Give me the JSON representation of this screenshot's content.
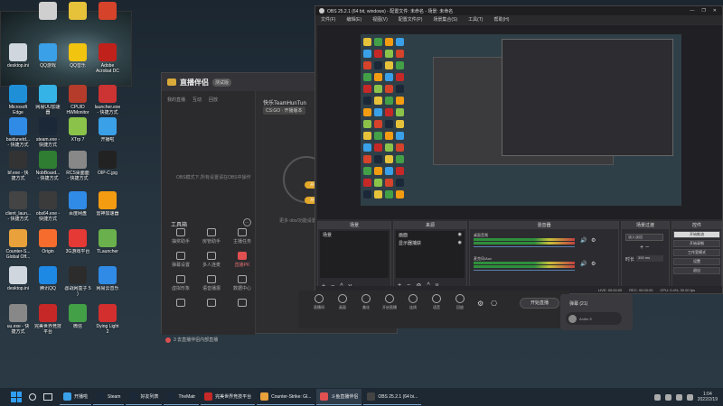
{
  "desktop": {
    "icons": [
      {
        "label": "",
        "color": "#cfcfcf"
      },
      {
        "label": "",
        "color": "#e6c23b"
      },
      {
        "label": "",
        "color": "#d4432a"
      },
      {
        "label": "desktop.ini",
        "color": "#cfd6de"
      },
      {
        "label": "QQ游戏",
        "color": "#3aa0e8"
      },
      {
        "label": "QQ音乐",
        "color": "#f1c40f"
      },
      {
        "label": "Adobe\nAcrobat DC",
        "color": "#c0211a"
      },
      {
        "label": "Microsoft\nEdge",
        "color": "#1f8fd8"
      },
      {
        "label": "网易UU加速\n器",
        "color": "#36b3e6"
      },
      {
        "label": "CPUID\nHWMonitor",
        "color": "#b53b2b"
      },
      {
        "label": "launcher.exe\n- 快捷方式",
        "color": "#cc3333"
      },
      {
        "label": "baidunetd...\n- 快捷方式",
        "color": "#2f8be6"
      },
      {
        "label": "steam.exe -\n快捷方式",
        "color": "#1b2838"
      },
      {
        "label": "XTrp 7",
        "color": "#8bc34a"
      },
      {
        "label": "开播啦",
        "color": "#3aa0e8"
      },
      {
        "label": "bf.exe - 快\n捷方式",
        "color": "#333333"
      },
      {
        "label": "NobBoard...\n- 快捷方式",
        "color": "#2e7d32"
      },
      {
        "label": "RCS桌面面\n- 快捷方式",
        "color": "#888888"
      },
      {
        "label": "OIP-C.jpg",
        "color": "#222222"
      },
      {
        "label": "client_laun...\n- 快捷方式",
        "color": "#444444"
      },
      {
        "label": "obs64.exe -\n快捷方式",
        "color": "#3b3b3b"
      },
      {
        "label": "百度网盘",
        "color": "#2f8be6"
      },
      {
        "label": "雷神加速器",
        "color": "#f39c12"
      },
      {
        "label": "Counter-S...\nGlobal Off...",
        "color": "#e8a13b"
      },
      {
        "label": "Origin",
        "color": "#f56c2d"
      },
      {
        "label": "3G游戏平台",
        "color": "#e53935"
      },
      {
        "label": "TLauncher",
        "color": "#6ab04c"
      },
      {
        "label": "desktop.ini",
        "color": "#cfd6de"
      },
      {
        "label": "腾讯QQ",
        "color": "#1e88e5"
      },
      {
        "label": "@战网盒子 5\n)",
        "color": "#2c2c2c"
      },
      {
        "label": "网易云音乐",
        "color": "#2f8be6"
      },
      {
        "label": "uu.exe - 快\n捷方式",
        "color": "#888888"
      },
      {
        "label": "完美世界竞技\n平台",
        "color": "#c62828"
      },
      {
        "label": "微信",
        "color": "#43a047"
      },
      {
        "label": "Dying Light\n2",
        "color": "#d32f2f"
      }
    ]
  },
  "assistant": {
    "app_name": "直播伴侣",
    "beta_tag": "测试版",
    "tabs": [
      "我的直播",
      "互动",
      "回放"
    ],
    "hint": "OBS模式下,所有设置请在OBS中操作",
    "tools_title": "工具箱",
    "tools": [
      "抽奖助手",
      "房管助手",
      "主播任务",
      "弹幕设置",
      "多人连麦",
      "直播PK",
      "虚拟形象",
      "语音播报",
      "数据中心",
      "",
      "",
      ""
    ],
    "stream_helper": "3 去直播伴侣内部直播",
    "team_name": "快乐TeamHunTun",
    "game_tag": "CS:GO · 开播版本",
    "pill_top": "开播",
    "pill_mid": "开播",
    "more_desc": "更多 obs/功能设置",
    "bottom_buttons": [
      "直播间",
      "画面",
      "美化",
      "开启直播",
      "连线",
      "语音",
      "回放"
    ],
    "start_live_label": "开始直播",
    "misc_icons": [
      "⚙",
      "⎔"
    ],
    "comments_title": "弹幕 (21)",
    "comment_user": "Antler E"
  },
  "obs": {
    "title": "OBS 25.2.1 (64 bit, windows) - 配置文件: 未命名 - 场景: 未命名",
    "menu": [
      "文件(F)",
      "编辑(E)",
      "视图(V)",
      "配置文件(P)",
      "场景集合(S)",
      "工具(T)",
      "帮助(H)"
    ],
    "window_controls": [
      "—",
      "❐",
      "✕"
    ],
    "panels": {
      "scenes": "场景",
      "sources": "来源",
      "mixer": "混音器",
      "transitions": "场景过渡",
      "controls": "控件"
    },
    "scenes_list": [
      "场景"
    ],
    "sources_list": [
      "画面",
      "显示器捕获"
    ],
    "mixer_tracks": [
      "桌面音频",
      "麦克风/Aux"
    ],
    "transition_select": "淡入淡出",
    "duration_label": "时长",
    "duration_value": "300 ms",
    "controls": [
      "开始推流",
      "开始录制",
      "工作室模式",
      "设置",
      "退出"
    ],
    "status": [
      "LIVE: 00:00:00",
      "REC: 00:00:00",
      "CPU: 0.4%, 30.00 fps"
    ],
    "mixer_icons": [
      "🔊",
      "⚙"
    ],
    "toolbar_icons": [
      "+",
      "−",
      "^",
      "v"
    ]
  },
  "taskbar": {
    "items": [
      {
        "label": "开播啦",
        "color": "#3aa0e8"
      },
      {
        "label": "Steam",
        "color": "#1b2838"
      },
      {
        "label": "好友列表",
        "color": "#1b2838"
      },
      {
        "label": "TheMatr",
        "color": "#1b2838"
      },
      {
        "label": "完美世界竞技平台",
        "color": "#c62828"
      },
      {
        "label": "Counter-Strike: Gl...",
        "color": "#e8a13b"
      },
      {
        "label": "斗鱼直播伴侣",
        "color": "#e05050"
      },
      {
        "label": "OBS 25.2.1 (64 bi...",
        "color": "#444444"
      }
    ],
    "time": "1:04",
    "date": "2022/2/19"
  }
}
